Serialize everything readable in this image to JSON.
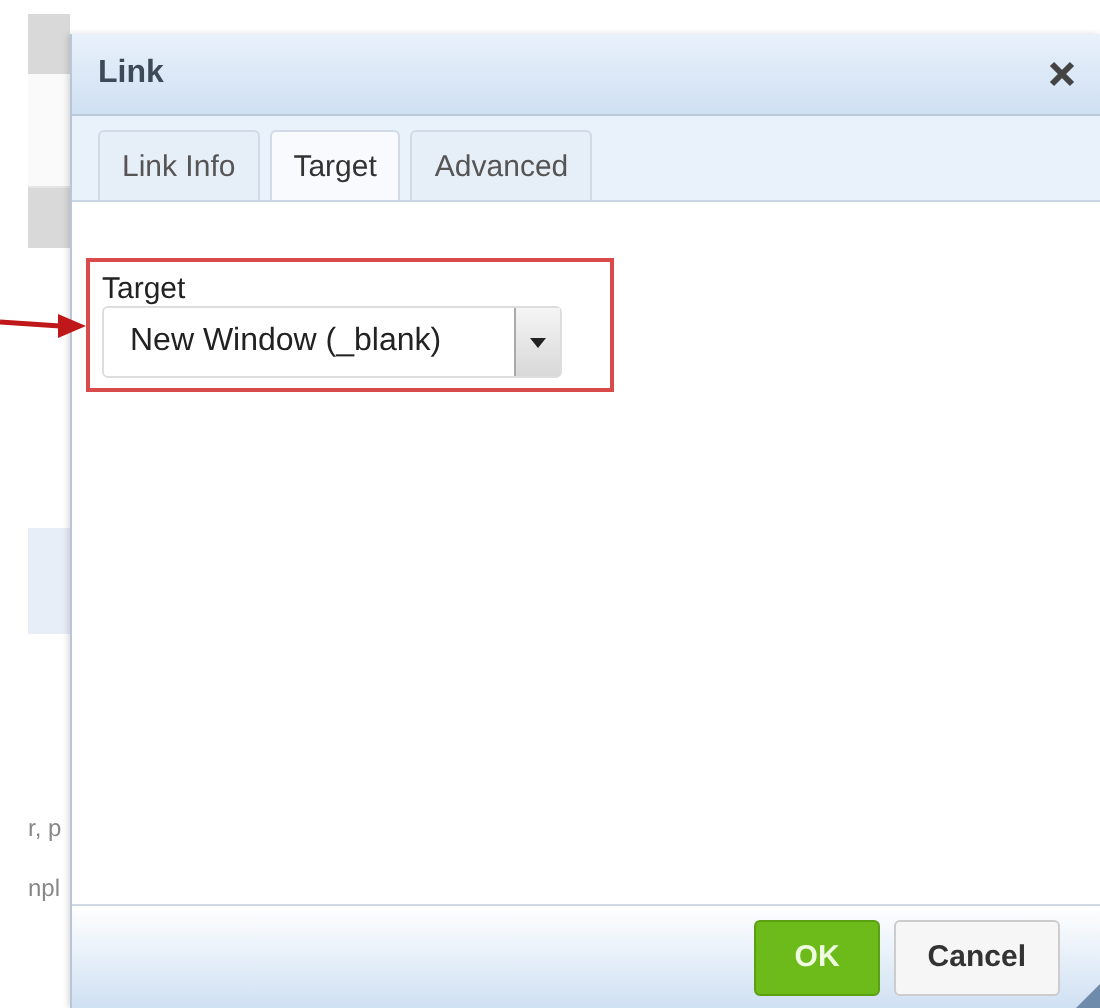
{
  "background": {
    "texts": [
      "r, p",
      "npl"
    ]
  },
  "dialog": {
    "title": "Link",
    "tabs": [
      {
        "label": "Link Info",
        "selected": false
      },
      {
        "label": "Target",
        "selected": true
      },
      {
        "label": "Advanced",
        "selected": false
      }
    ],
    "target_field": {
      "label": "Target",
      "value": "New Window (_blank)",
      "highlighted": true
    },
    "buttons": [
      {
        "label": "OK",
        "kind": "primary"
      },
      {
        "label": "Cancel",
        "kind": "secondary"
      }
    ]
  }
}
